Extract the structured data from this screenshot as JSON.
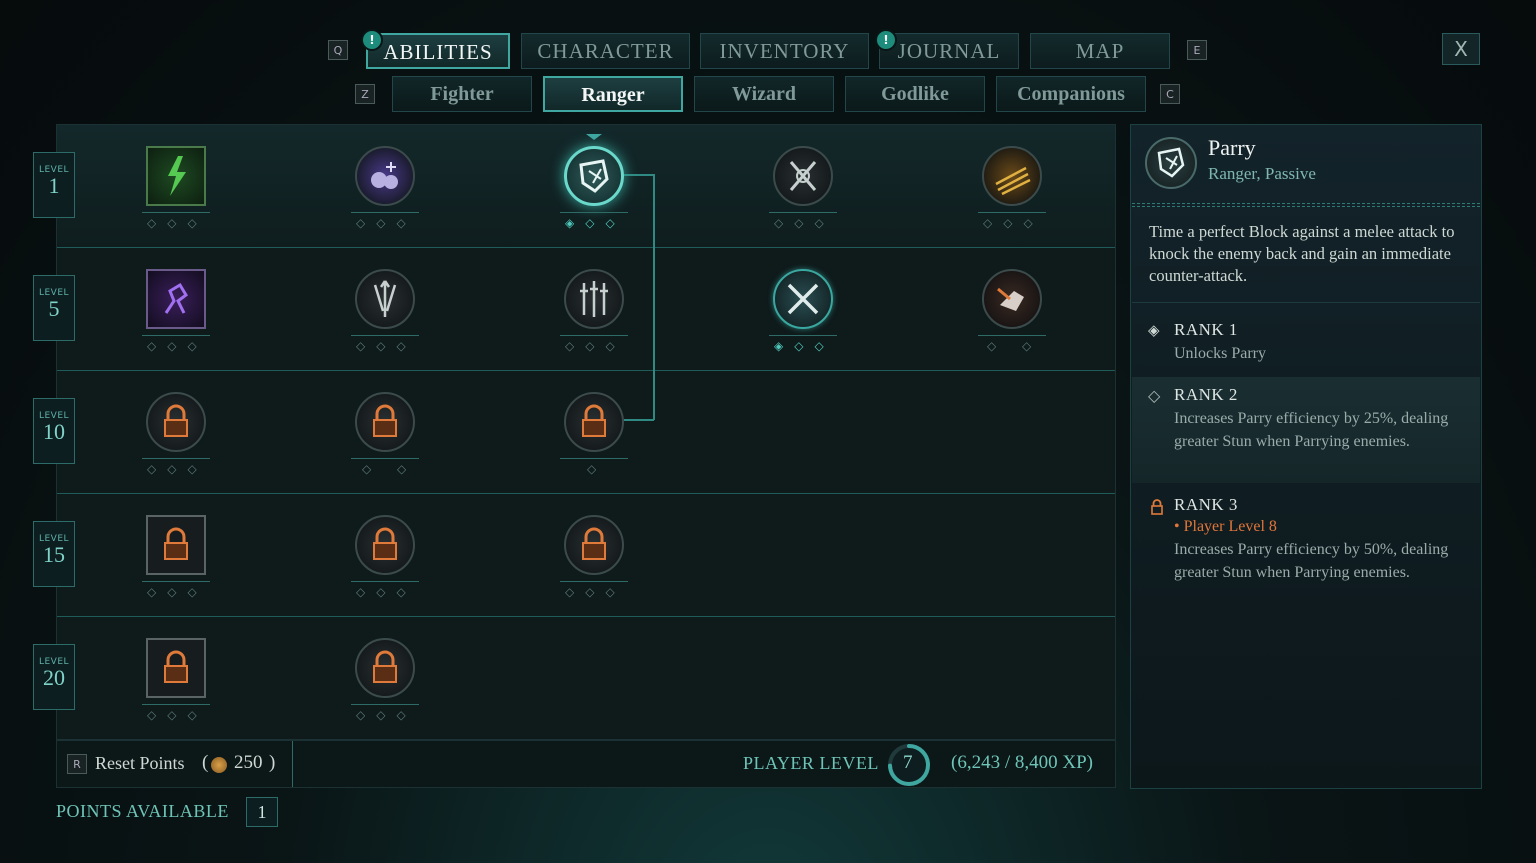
{
  "nav": {
    "key_left": "Q",
    "key_right": "E",
    "tabs": [
      {
        "label": "ABILITIES",
        "active": true,
        "notify": true
      },
      {
        "label": "CHARACTER",
        "active": false,
        "notify": false
      },
      {
        "label": "INVENTORY",
        "active": false,
        "notify": false
      },
      {
        "label": "JOURNAL",
        "active": false,
        "notify": true
      },
      {
        "label": "MAP",
        "active": false,
        "notify": false
      }
    ],
    "notify_glyph": "!",
    "close_label": "X"
  },
  "subnav": {
    "key_left": "Z",
    "key_right": "C",
    "tabs": [
      {
        "label": "Fighter",
        "active": false
      },
      {
        "label": "Ranger",
        "active": true
      },
      {
        "label": "Wizard",
        "active": false
      },
      {
        "label": "Godlike",
        "active": false
      },
      {
        "label": "Companions",
        "active": false
      }
    ]
  },
  "levels": [
    {
      "label": "LEVEL",
      "num": "1"
    },
    {
      "label": "LEVEL",
      "num": "5"
    },
    {
      "label": "LEVEL",
      "num": "10"
    },
    {
      "label": "LEVEL",
      "num": "15"
    },
    {
      "label": "LEVEL",
      "num": "20"
    }
  ],
  "nodes": {
    "row1": [
      {
        "name": "lightning-ability-icon",
        "shape": "square",
        "state": "unlocked",
        "pips": "◇◇◇"
      },
      {
        "name": "bombs-ability-icon",
        "shape": "circle",
        "state": "unlocked",
        "pips": "◇◇◇"
      },
      {
        "name": "parry-ability-icon",
        "shape": "circle",
        "state": "selected",
        "pips": "◈◇◇"
      },
      {
        "name": "crossed-blades-ability-icon",
        "shape": "circle",
        "state": "unlocked",
        "pips": "◇◇◇"
      },
      {
        "name": "claw-strike-ability-icon",
        "shape": "circle",
        "state": "unlocked",
        "pips": "◇◇◇"
      }
    ],
    "row5": [
      {
        "name": "leap-ability-icon",
        "shape": "square",
        "state": "unlocked",
        "pips": "◇◇◇"
      },
      {
        "name": "arrow-volley-ability-icon",
        "shape": "circle",
        "state": "unlocked",
        "pips": "◇◇◇"
      },
      {
        "name": "weapon-mastery-ability-icon",
        "shape": "circle",
        "state": "unlocked",
        "pips": "◇◇◇"
      },
      {
        "name": "dual-blades-ability-icon",
        "shape": "circle",
        "state": "learned",
        "pips": "◈◇◇"
      },
      {
        "name": "grapple-ability-icon",
        "shape": "circle",
        "state": "unlocked",
        "pips": "◇ ◇"
      }
    ],
    "row10": [
      {
        "name": "locked-ability-icon",
        "shape": "circle",
        "state": "locked",
        "pips": "◇◇◇"
      },
      {
        "name": "locked-ability-icon",
        "shape": "circle",
        "state": "locked",
        "pips": "◇ ◇"
      },
      {
        "name": "locked-ability-icon",
        "shape": "circle",
        "state": "locked",
        "pips": "◇"
      }
    ],
    "row15": [
      {
        "name": "locked-ability-icon",
        "shape": "square",
        "state": "locked",
        "pips": "◇◇◇"
      },
      {
        "name": "locked-ability-icon",
        "shape": "circle",
        "state": "locked",
        "pips": "◇◇◇"
      },
      {
        "name": "locked-ability-icon",
        "shape": "circle",
        "state": "locked",
        "pips": "◇◇◇"
      }
    ],
    "row20": [
      {
        "name": "locked-ability-icon",
        "shape": "square",
        "state": "locked",
        "pips": "◇◇◇"
      },
      {
        "name": "locked-ability-icon",
        "shape": "circle",
        "state": "locked",
        "pips": "◇◇◇"
      }
    ]
  },
  "footer": {
    "reset_key": "R",
    "reset_label": "Reset Points",
    "reset_open": "(",
    "reset_cost": "250",
    "reset_close": ")",
    "player_level_label": "PLAYER LEVEL",
    "player_level": "7",
    "xp_text": "(6,243 / 8,400 XP)",
    "xp_progress": 0.743,
    "points_label": "POINTS AVAILABLE",
    "points_value": "1"
  },
  "detail": {
    "title": "Parry",
    "subtitle": "Ranger, Passive",
    "description": "Time a perfect Block against a melee attack to knock the enemy back and gain an immediate counter-attack.",
    "ranks": [
      {
        "title": "RANK 1",
        "text": "Unlocks Parry",
        "requirement": "",
        "icon": "◈",
        "state": "learned"
      },
      {
        "title": "RANK 2",
        "text": "Increases Parry efficiency by 25%, dealing greater Stun when Parrying enemies.",
        "requirement": "",
        "icon": "◇",
        "state": "available"
      },
      {
        "title": "RANK 3",
        "text": "Increases Parry efficiency by 50%, dealing greater Stun when Parrying enemies.",
        "requirement": "• Player Level 8",
        "icon": "lock",
        "state": "locked"
      }
    ]
  },
  "colors": {
    "accent": "#3fa6a0",
    "locked_orange": "#e07a3a",
    "requirement_text": "#e0763a"
  }
}
